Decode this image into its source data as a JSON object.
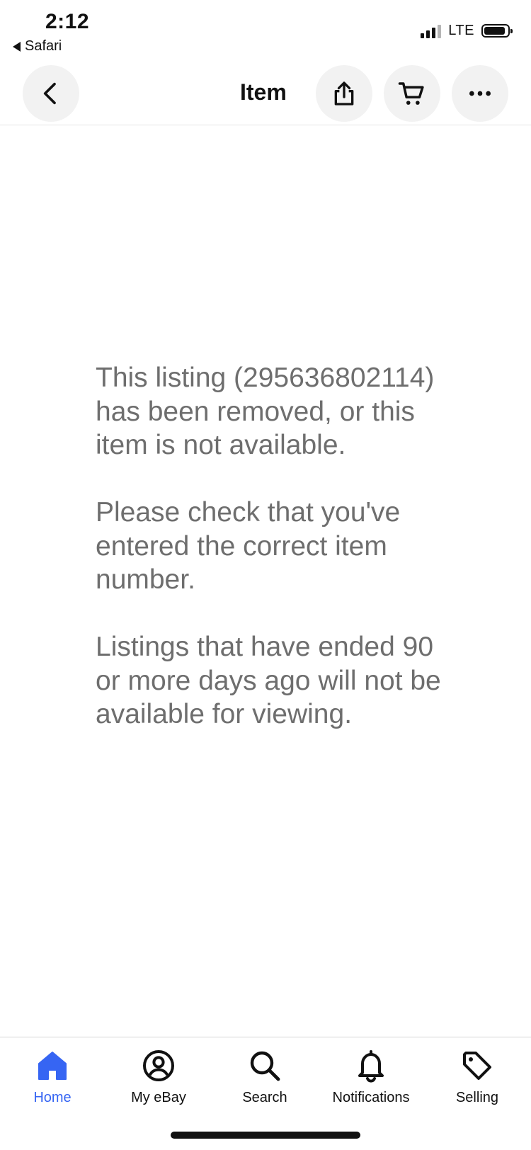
{
  "status_bar": {
    "time": "2:12",
    "back_app": "Safari",
    "network": "LTE",
    "signal_bars": 3,
    "battery_level": 0.9
  },
  "nav": {
    "title": "Item",
    "back_icon": "chevron-left-icon",
    "share_icon": "share-icon",
    "cart_icon": "cart-icon",
    "more_icon": "more-horizontal-icon"
  },
  "message": {
    "paragraphs": [
      "This listing (295636802114) has been removed, or this item is not available.",
      "Please check that you've entered the correct item number.",
      "Listings that have ended 90 or more days ago will not be available for viewing."
    ]
  },
  "tabbar": {
    "active_color": "#3665f3",
    "items": [
      {
        "label": "Home",
        "icon": "home-icon",
        "active": true
      },
      {
        "label": "My eBay",
        "icon": "user-circle-icon",
        "active": false
      },
      {
        "label": "Search",
        "icon": "search-icon",
        "active": false
      },
      {
        "label": "Notifications",
        "icon": "bell-icon",
        "active": false
      },
      {
        "label": "Selling",
        "icon": "tag-icon",
        "active": false
      }
    ]
  }
}
